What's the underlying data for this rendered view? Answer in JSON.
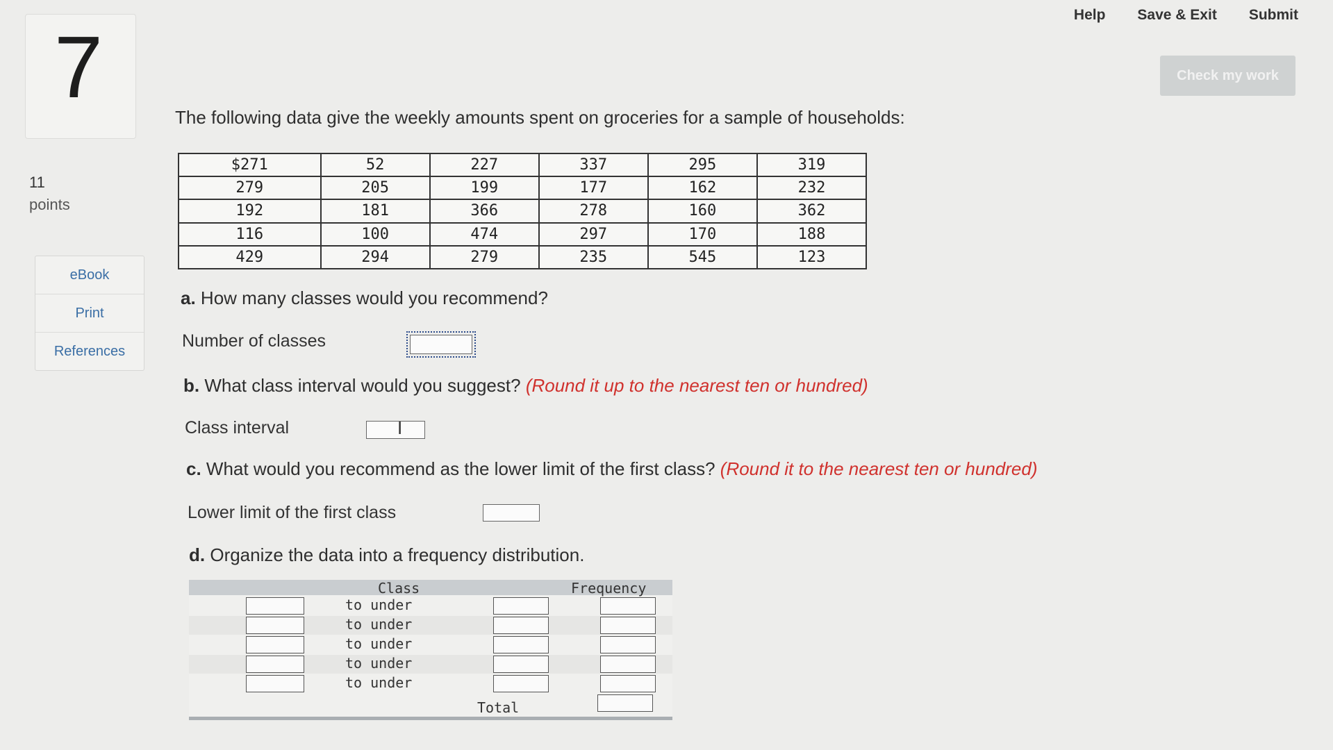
{
  "nav": {
    "help": "Help",
    "save_exit": "Save & Exit",
    "submit": "Submit",
    "check_my_work": "Check my work"
  },
  "question": {
    "number": "7",
    "points_value": "11",
    "points_label": "points"
  },
  "side_tools": [
    {
      "label": "eBook"
    },
    {
      "label": "Print"
    },
    {
      "label": "References"
    }
  ],
  "intro": "The following data give the weekly amounts spent on groceries for a sample of households:",
  "data_table": [
    [
      "$271",
      "52",
      "227",
      "337",
      "295",
      "319"
    ],
    [
      "279",
      "205",
      "199",
      "177",
      "162",
      "232"
    ],
    [
      "192",
      "181",
      "366",
      "278",
      "160",
      "362"
    ],
    [
      "116",
      "100",
      "474",
      "297",
      "170",
      "188"
    ],
    [
      "429",
      "294",
      "279",
      "235",
      "545",
      "123"
    ]
  ],
  "part_a": {
    "letter": "a.",
    "text": "How many classes would you recommend?",
    "field_label": "Number of classes",
    "value": ""
  },
  "part_b": {
    "letter": "b.",
    "text": "What class interval would you suggest?",
    "hint": "(Round it up to the nearest ten or hundred)",
    "field_label": "Class interval",
    "value": ""
  },
  "part_c": {
    "letter": "c.",
    "text": "What would you recommend as the lower limit of the first class?",
    "hint": "(Round it to the nearest ten or hundred)",
    "field_label": "Lower limit of the first class",
    "value": ""
  },
  "part_d": {
    "letter": "d.",
    "text": "Organize the data into a frequency distribution."
  },
  "freq_table": {
    "class_header": "Class",
    "frequency_header": "Frequency",
    "rows": [
      {
        "connector": "to under"
      },
      {
        "connector": "to under"
      },
      {
        "connector": "to under"
      },
      {
        "connector": "to under"
      },
      {
        "connector": "to under"
      }
    ],
    "total_label": "Total"
  }
}
